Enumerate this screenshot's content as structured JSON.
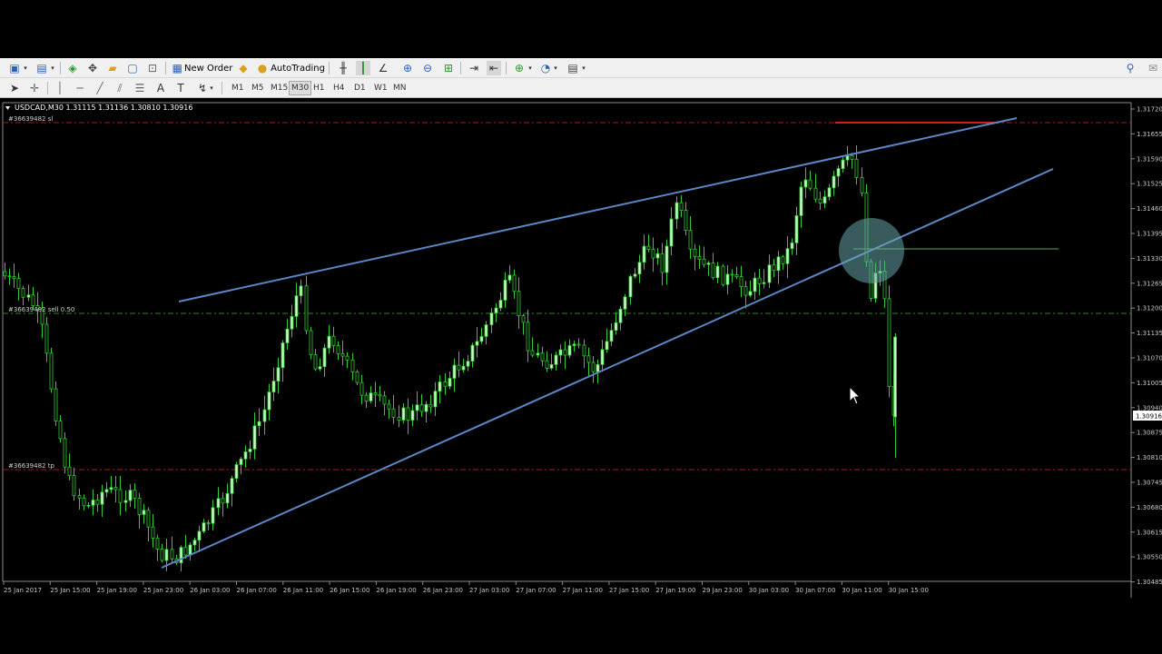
{
  "toolbar1": {
    "new_order_label": "New Order",
    "autotrading_label": "AutoTrading"
  },
  "toolbar2": {
    "timeframes": [
      "M1",
      "M5",
      "M15",
      "M30",
      "H1",
      "H4",
      "D1",
      "W1",
      "MN"
    ],
    "active_timeframe": "M30"
  },
  "chart": {
    "header": "USDCAD,M30  1.31115 1.31136 1.30810 1.30916",
    "sl_label": "#36639482 sl",
    "entry_label": "#36639482 sell 0.50",
    "tp_label": "#36639482 tp",
    "current_price": "1.30916",
    "price_labels": [
      "1.31720",
      "1.31655",
      "1.31590",
      "1.31525",
      "1.31460",
      "1.31395",
      "1.31330",
      "1.31265",
      "1.31200",
      "1.31135",
      "1.31070",
      "1.31005",
      "1.30940",
      "1.30875",
      "1.30810",
      "1.30745",
      "1.30680",
      "1.30615",
      "1.30550",
      "1.30485"
    ],
    "time_labels": [
      "25 Jan 2017",
      "25 Jan 15:00",
      "25 Jan 19:00",
      "25 Jan 23:00",
      "26 Jan 03:00",
      "26 Jan 07:00",
      "26 Jan 11:00",
      "26 Jan 15:00",
      "26 Jan 19:00",
      "26 Jan 23:00",
      "27 Jan 03:00",
      "27 Jan 07:00",
      "27 Jan 11:00",
      "27 Jan 15:00",
      "27 Jan 19:00",
      "29 Jan 23:00",
      "30 Jan 03:00",
      "30 Jan 07:00",
      "30 Jan 11:00",
      "30 Jan 15:00"
    ],
    "colors": {
      "background": "#000000",
      "bull_candle": "#ccffcc",
      "bear_candle": "#000000",
      "wick": "#33cc33",
      "trendline": "#5b86c6",
      "sl_tp_line": "#b01818",
      "entry_line": "#2a8a2a",
      "highlight": "#6aa6aa"
    }
  },
  "chart_data": {
    "type": "candlestick",
    "symbol": "USDCAD",
    "timeframe": "M30",
    "ylim": [
      1.30485,
      1.3172
    ],
    "levels": {
      "sl": 1.31685,
      "entry": 1.31185,
      "tp": 1.30775
    },
    "last": {
      "open": 1.31115,
      "high": 1.31136,
      "low": 1.3081,
      "close": 1.30916
    }
  }
}
